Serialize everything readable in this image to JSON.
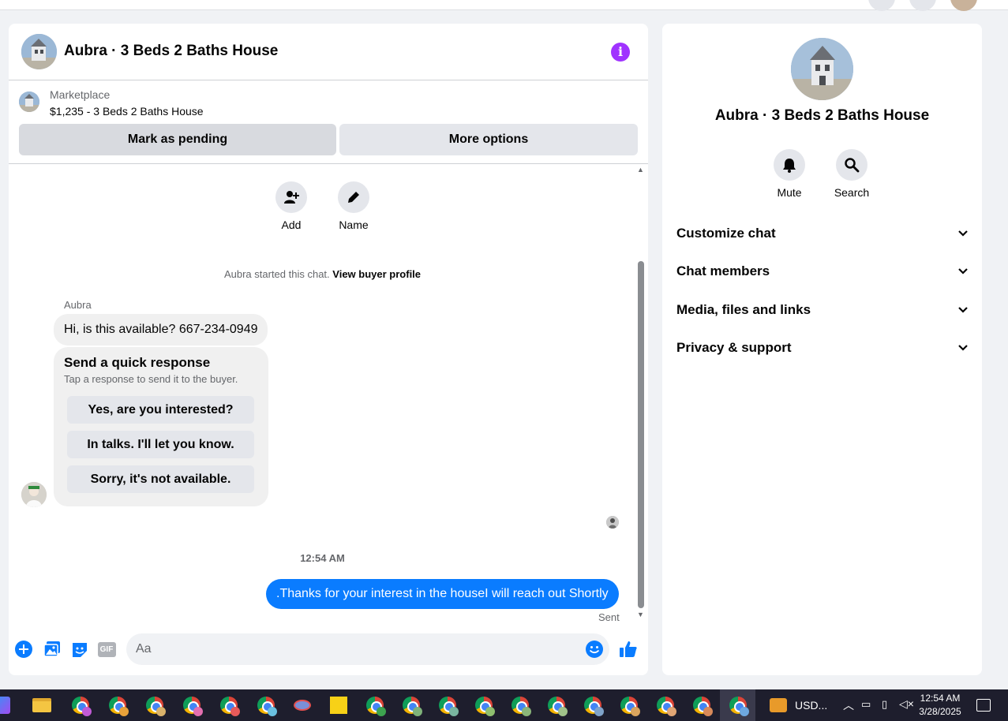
{
  "chat": {
    "title": "Aubra · 3 Beds 2 Baths House",
    "info_icon": "i",
    "marketplace_label": "Marketplace",
    "listing": "$1,235 - 3 Beds 2 Baths House",
    "mark_pending": "Mark as pending",
    "more_options": "More options",
    "actions": [
      {
        "icon": "add-person-icon",
        "label": "Add"
      },
      {
        "icon": "pencil-icon",
        "label": "Name"
      }
    ],
    "started_text": "Aubra started this chat.",
    "view_profile": "View buyer profile",
    "sender_name": "Aubra",
    "incoming_message": "Hi, is this available? 667-234-0949",
    "quick_response": {
      "title": "Send a quick response",
      "subtitle": "Tap a response to send it to the buyer.",
      "options": [
        "Yes, are you interested?",
        "In talks. I'll let you know.",
        "Sorry, it's not available."
      ]
    },
    "timestamp": "12:54 AM",
    "outgoing_message": ".Thanks for your interest in the houseI will reach out Shortly",
    "sent_status": "Sent",
    "composer_placeholder": "Aa",
    "composer_icons": [
      "plus-icon",
      "photo-icon",
      "sticker-icon",
      "gif-icon",
      "emoji-icon",
      "like-icon"
    ],
    "gif_label": "GIF"
  },
  "info": {
    "title": "Aubra · 3 Beds 2 Baths House",
    "actions": [
      {
        "icon": "bell-icon",
        "label": "Mute"
      },
      {
        "icon": "search-icon",
        "label": "Search"
      }
    ],
    "sections": [
      "Customize chat",
      "Chat members",
      "Media, files and links",
      "Privacy & support"
    ]
  },
  "taskbar": {
    "currency": "USD...",
    "time": "12:54 AM",
    "date": "3/28/2025"
  },
  "colors": {
    "accent": "#0a7cff",
    "info_purple": "#a033ff",
    "taskbar": "#1e1e2d"
  }
}
